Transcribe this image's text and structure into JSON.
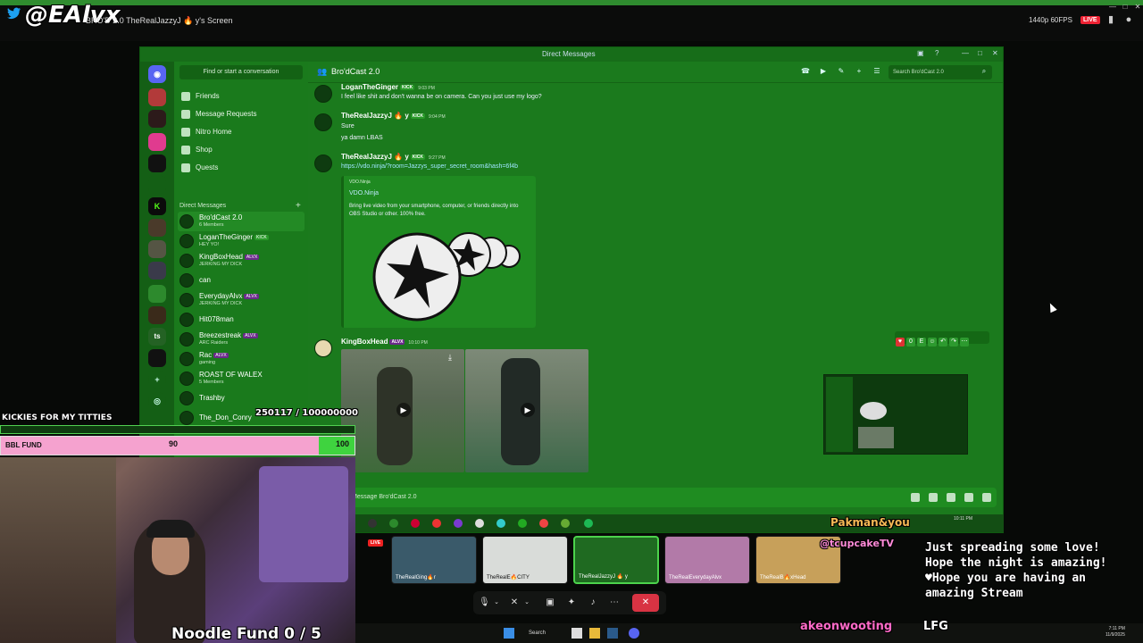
{
  "top_bar": {
    "twitter_handle": "@EAlvx",
    "screen_label": "BRO'D   2.0  TheRealJazzyJ 🔥 y's Screen",
    "resolution": "1440p 60FPS",
    "live": "LIVE"
  },
  "discord": {
    "window_title": "Direct Messages",
    "find_placeholder": "Find or start a conversation",
    "nav": [
      "Friends",
      "Message Requests",
      "Nitro Home",
      "Shop",
      "Quests"
    ],
    "dm_header": "Direct Messages",
    "dms": [
      {
        "name": "Bro'dCast 2.0",
        "sub": "6 Members",
        "tag": ""
      },
      {
        "name": "LoganTheGinger",
        "sub": "HEY YO!",
        "tag": "KICK"
      },
      {
        "name": "KingBoxHead",
        "sub": "JERKING MY DICK",
        "tag": "ALVX"
      },
      {
        "name": "can",
        "sub": "",
        "tag": ""
      },
      {
        "name": "EverydayAlvx",
        "sub": "JERKING MY DICK",
        "tag": "ALVX"
      },
      {
        "name": "Hit078man",
        "sub": "",
        "tag": ""
      },
      {
        "name": "Breezestreak",
        "sub": "ARC Raiders",
        "tag": "ALVX"
      },
      {
        "name": "Rac",
        "sub": "gaming",
        "tag": "ALVX"
      },
      {
        "name": "ROAST OF WALEX",
        "sub": "5 Members",
        "tag": ""
      },
      {
        "name": "Trashby",
        "sub": "",
        "tag": ""
      },
      {
        "name": "The_Don_Conry",
        "sub": "",
        "tag": ""
      }
    ],
    "channel_title": "Bro'dCast 2.0",
    "search_placeholder": "Search Bro'dCast 2.0",
    "messages": [
      {
        "author": "LoganTheGinger",
        "tag": "KICK",
        "time": "9:03 PM",
        "lines": [
          "I feel like shit and don't wanna be on camera. Can you just use my logo?"
        ]
      },
      {
        "author": "TheRealJazzyJ 🔥 y",
        "tag": "KICK",
        "time": "9:04 PM",
        "lines": [
          "Sure",
          "ya damn LBAS"
        ]
      },
      {
        "author": "TheRealJazzyJ 🔥 y",
        "tag": "KICK",
        "time": "9:27 PM",
        "lines": [
          "https://vdo.ninja/?room=Jazzys_super_secret_room&hash=6f4b"
        ]
      },
      {
        "author": "KingBoxHead",
        "tag": "ALVX",
        "time": "10:10 PM",
        "lines": []
      }
    ],
    "embed": {
      "provider": "VDO.Ninja",
      "title": "VDO.Ninja",
      "description": "Bring live video from your smartphone, computer, or friends directly into OBS Studio or other. 100% free."
    },
    "message_placeholder": "Message Bro'dCast 2.0",
    "taskbar_time": "10:11 PM"
  },
  "overlay": {
    "kickies": "KICKIES FOR MY TITTIES",
    "kickies_counter": "250117 / 100000000",
    "fund_label": "BBL FUND",
    "fund_current": "90",
    "fund_goal": "100",
    "fund_progress": 0.9,
    "noodle_fund": "Noodle Fund  0 / 5",
    "pakman": "Pakman&you",
    "cupcake": "@tcupcakeTV",
    "chat_message": "Just spreading some love! Hope the night is amazing! ♥Hope you are having an amazing Stream",
    "lfg_user": "akeonwooting",
    "lfg_text": "LFG"
  },
  "stream_thumbs": [
    {
      "label": "TheRealGing🔥r",
      "live": "LIVE"
    },
    {
      "label": "TheRealE🔥CITY"
    },
    {
      "label": "TheRealJazzyJ 🔥 y"
    },
    {
      "label": "TheRealEverydayAlvx"
    },
    {
      "label": "TheRealB🔥xHead"
    }
  ],
  "windows": {
    "search": "Search",
    "time": "7:11 PM",
    "date": "11/9/2025"
  },
  "colors": {
    "discord_green": "#1b7a1d",
    "fund_pink": "#f5a2cf",
    "fund_green": "#3fd33f",
    "leave_red": "#d83343"
  }
}
